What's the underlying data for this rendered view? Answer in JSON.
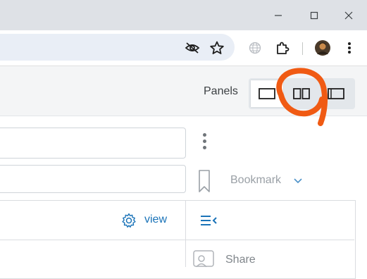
{
  "window": {
    "controls": [
      {
        "name": "minimize",
        "icon": "minimize-icon"
      },
      {
        "name": "maximize",
        "icon": "maximize-icon"
      },
      {
        "name": "close",
        "icon": "close-icon"
      }
    ]
  },
  "toolbar": {
    "icons": [
      "eye-slash-icon",
      "star-icon",
      "extension-globe-icon",
      "puzzle-icon",
      "avatar",
      "more-vert-icon"
    ]
  },
  "panels": {
    "label": "Panels",
    "options": [
      {
        "name": "single-panel",
        "icon": "single-panel-icon",
        "active": true
      },
      {
        "name": "dual-panel",
        "icon": "dual-panel-icon",
        "active": false
      },
      {
        "name": "side-panel",
        "icon": "side-panel-icon",
        "active": false
      }
    ]
  },
  "bookmark": {
    "label": "Bookmark"
  },
  "view": {
    "label": "view"
  },
  "share": {
    "label": "Share"
  },
  "colors": {
    "titlebar": "#dee1e6",
    "omnibox": "#e9eef6",
    "accent": "#1a73b8",
    "annotation": "#f05a13"
  }
}
